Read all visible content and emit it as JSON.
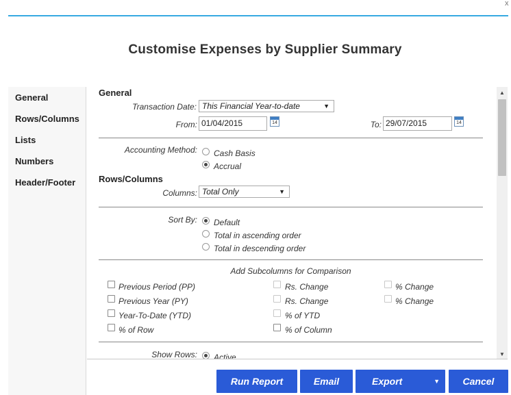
{
  "window": {
    "close_glyph": "x"
  },
  "dialog": {
    "title": "Customise Expenses by Supplier Summary"
  },
  "nav": {
    "items": [
      {
        "label": "General"
      },
      {
        "label": "Rows/Columns"
      },
      {
        "label": "Lists"
      },
      {
        "label": "Numbers"
      },
      {
        "label": "Header/Footer"
      }
    ]
  },
  "general": {
    "heading": "General",
    "transaction_date_label": "Transaction Date:",
    "transaction_date_value": "This Financial Year-to-date",
    "from_label": "From:",
    "from_value": "01/04/2015",
    "to_label": "To:",
    "to_value": "29/07/2015",
    "calendar_day": "14",
    "accounting_method_label": "Accounting Method:",
    "cash_basis": "Cash Basis",
    "accrual": "Accrual"
  },
  "rows_columns": {
    "heading": "Rows/Columns",
    "columns_label": "Columns:",
    "columns_value": "Total Only",
    "sort_by_label": "Sort By:",
    "sort_default": "Default",
    "sort_asc": "Total in ascending order",
    "sort_desc": "Total in descending order",
    "subcolumns_heading": "Add Subcolumns for Comparison",
    "previous_period": "Previous Period (PP)",
    "previous_year": "Previous Year (PY)",
    "year_to_date": "Year-To-Date (YTD)",
    "pct_of_row": "% of Row",
    "rs_change_1": "Rs. Change",
    "rs_change_2": "Rs. Change",
    "pct_of_ytd": "% of YTD",
    "pct_of_column": "% of Column",
    "pct_change_1": "% Change",
    "pct_change_2": "% Change",
    "show_rows_label": "Show Rows:",
    "show_rows_active": "Active"
  },
  "footer": {
    "run_report": "Run Report",
    "email": "Email",
    "export": "Export",
    "cancel": "Cancel"
  },
  "colors": {
    "accent_rule": "#36a9e1",
    "button_blue": "#2a5bd7"
  },
  "icons": [
    "close-icon",
    "calendar-icon",
    "dropdown-arrow-icon",
    "scroll-up-icon",
    "scroll-down-icon"
  ]
}
